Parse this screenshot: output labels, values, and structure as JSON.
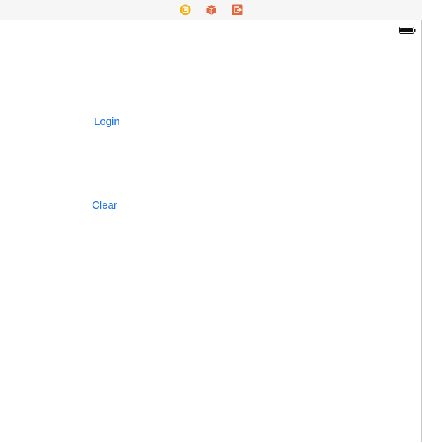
{
  "scene_dock": {
    "icons": [
      {
        "name": "view-controller-icon",
        "color": "#f1b00c"
      },
      {
        "name": "first-responder-icon",
        "color": "#e3683d"
      },
      {
        "name": "exit-icon",
        "color": "#e3683d"
      }
    ]
  },
  "status_bar": {
    "battery_icon": "battery-icon"
  },
  "buttons": {
    "login_label": "Login",
    "clear_label": "Clear",
    "tint_color": "#1a73e8"
  }
}
